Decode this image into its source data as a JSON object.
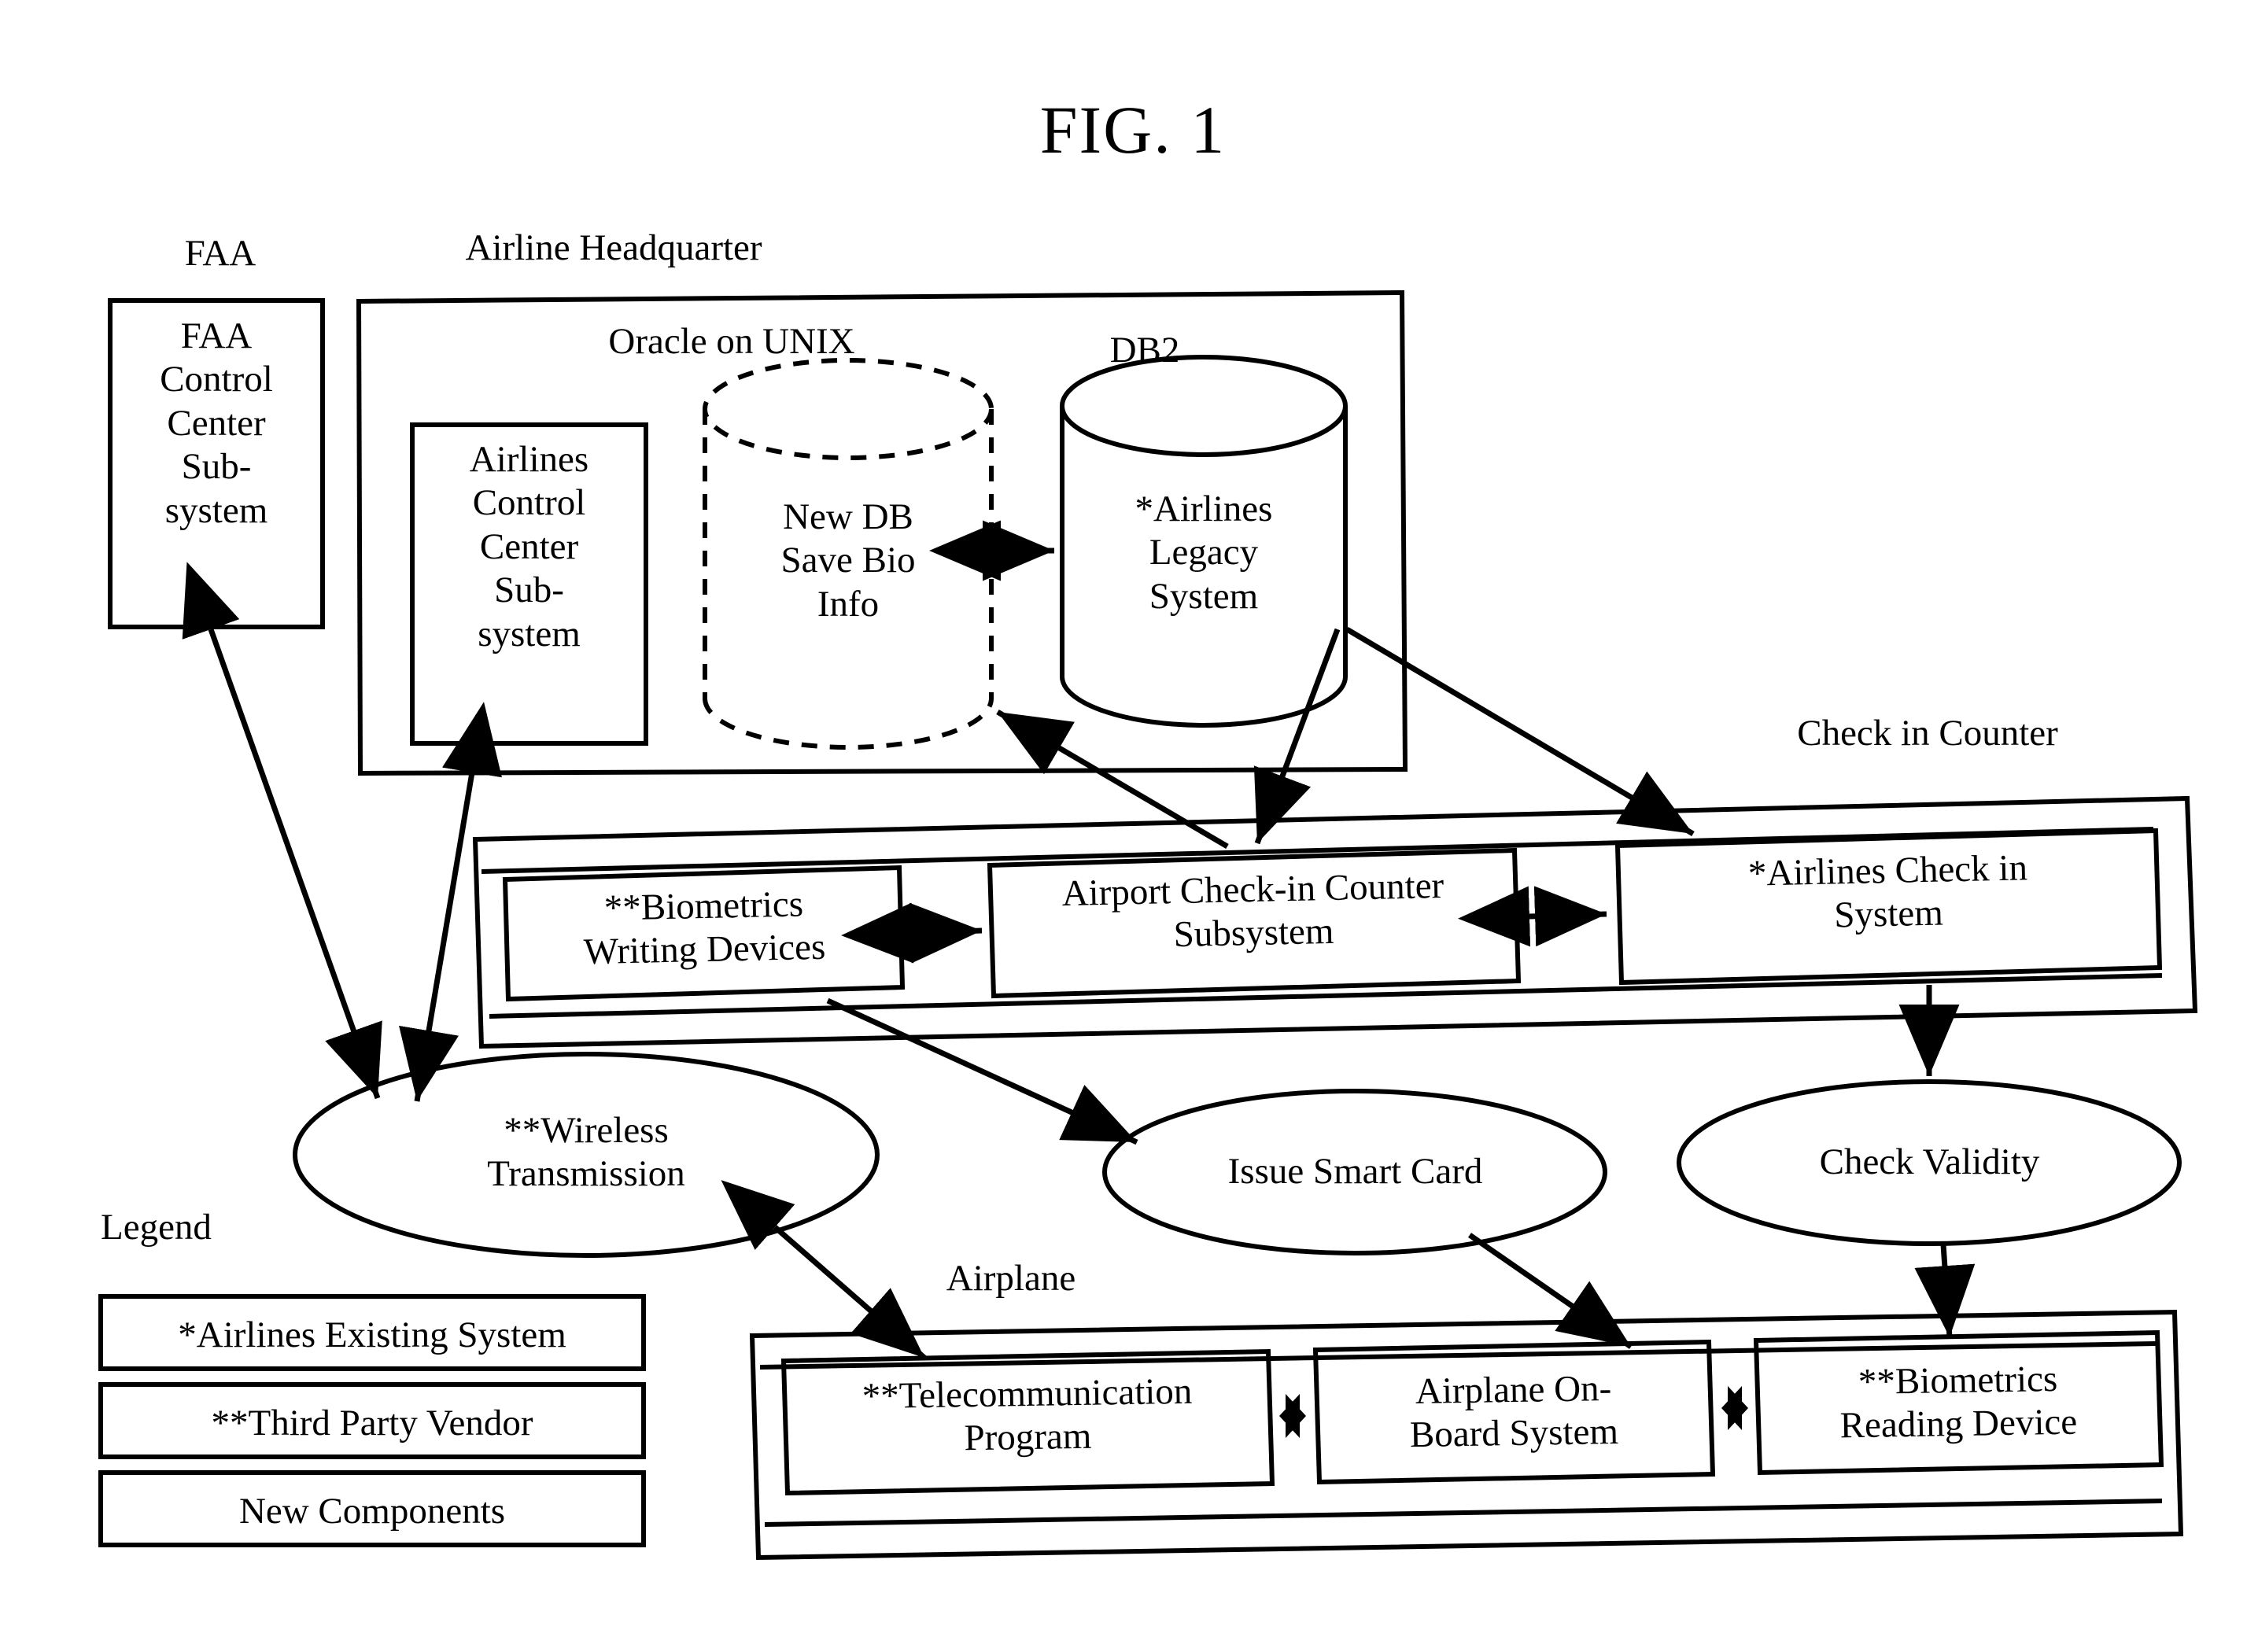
{
  "figure": {
    "title": "FIG. 1"
  },
  "groups": {
    "faa": {
      "label": "FAA"
    },
    "airline_hq": {
      "label": "Airline Headquarter"
    },
    "oracle": {
      "label": "Oracle on UNIX"
    },
    "db2": {
      "label": "DB2"
    },
    "check_in_counter": {
      "label": "Check in Counter"
    },
    "airplane": {
      "label": "Airplane"
    },
    "legend": {
      "label": "Legend"
    }
  },
  "nodes": {
    "faa_control_center": {
      "label": "FAA\nControl\nCenter\nSub-\nsystem"
    },
    "airlines_control_center": {
      "label": "Airlines\nControl\nCenter\nSub-\nsystem"
    },
    "new_db": {
      "label": "New DB\nSave Bio\nInfo"
    },
    "airlines_legacy": {
      "label": "*Airlines\nLegacy\nSystem"
    },
    "biometrics_writing": {
      "label": "**Biometrics\nWriting Devices"
    },
    "airport_checkin": {
      "label": "Airport Check-in Counter\nSubsystem"
    },
    "airlines_checkin": {
      "label": "*Airlines Check in\nSystem"
    },
    "wireless_transmission": {
      "label": "**Wireless\nTransmission"
    },
    "issue_smart_card": {
      "label": "Issue Smart Card"
    },
    "check_validity": {
      "label": "Check Validity"
    },
    "telecommunication": {
      "label": "**Telecommunication\nProgram"
    },
    "onboard_system": {
      "label": "Airplane On-\nBoard System"
    },
    "biometrics_reading": {
      "label": "**Biometrics\nReading Device"
    }
  },
  "legend": {
    "items": [
      {
        "label": "*Airlines Existing System"
      },
      {
        "label": "**Third Party Vendor"
      },
      {
        "label": "New Components"
      }
    ]
  },
  "colors": {
    "stroke": "#000000",
    "background": "#ffffff"
  }
}
